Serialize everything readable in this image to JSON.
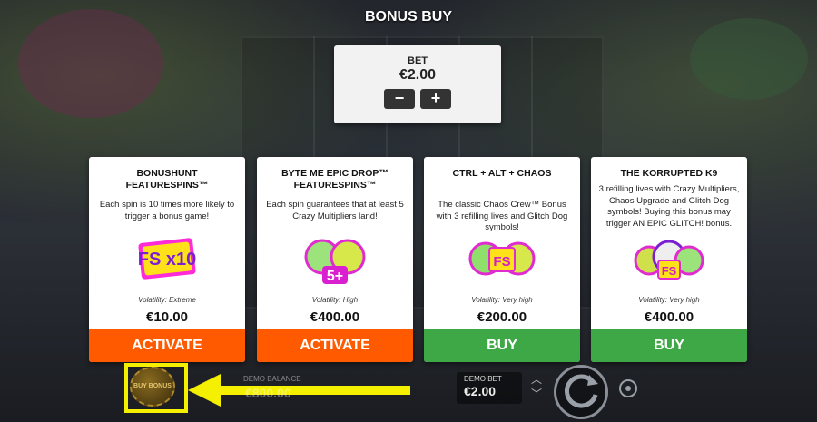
{
  "header": {
    "title": "BONUS BUY"
  },
  "bet_panel": {
    "label": "BET",
    "value": "€2.00",
    "minus": "−",
    "plus": "+"
  },
  "cards": [
    {
      "title": "BONUSHUNT FEATURESPINS™",
      "description": "Each spin is 10 times more likely to trigger a bonus game!",
      "art_text": "FS x10",
      "volatility": "Volatility: Extreme",
      "price": "€10.00",
      "button": "ACTIVATE",
      "button_color": "#ff5a00"
    },
    {
      "title": "BYTE ME EPIC DROP™ FEATURESPINS™",
      "description": "Each spin guarantees that at least 5 Crazy Multipliers land!",
      "art_text": "5+",
      "volatility": "Volatility: High",
      "price": "€400.00",
      "button": "ACTIVATE",
      "button_color": "#ff5a00"
    },
    {
      "title": "CTRL + ALT + CHAOS",
      "description": "The classic Chaos Crew™ Bonus with 3 refilling lives and Glitch Dog symbols!",
      "art_text": "FS",
      "volatility": "Volatility: Very high",
      "price": "€200.00",
      "button": "BUY",
      "button_color": "#3da845"
    },
    {
      "title": "THE KORRUPTED K9",
      "description": "3 refilling lives with Crazy Multipliers, Chaos Upgrade and Glitch Dog symbols! Buying this bonus may trigger AN EPIC GLITCH! bonus.",
      "art_text": "FS",
      "volatility": "Volatility: Very high",
      "price": "€400.00",
      "button": "BUY",
      "button_color": "#3da845"
    }
  ],
  "bottom_bar": {
    "buy_bonus_label": "BUY BONUS",
    "balance_label": "DEMO BALANCE",
    "balance_value": "€800.00",
    "demo_bet_label": "DEMO BET",
    "demo_bet_value": "€2.00",
    "highlight_color": "#f5f000"
  }
}
